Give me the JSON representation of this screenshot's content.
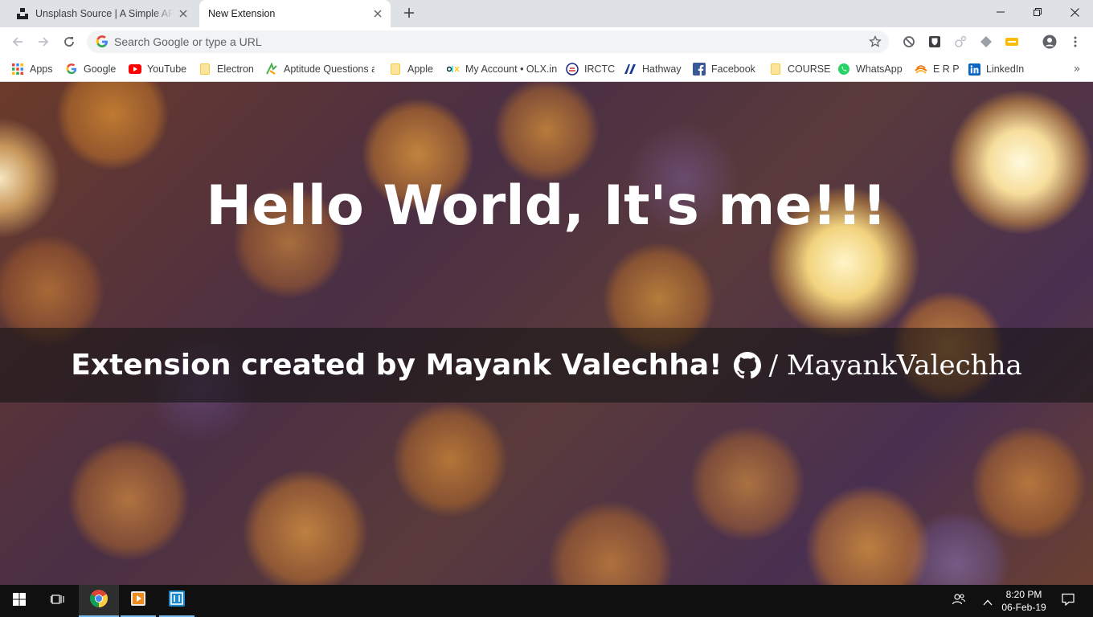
{
  "browser": {
    "tabs": [
      {
        "title": "Unsplash Source | A Simple API for Embedding Free Photos",
        "favicon": "unsplash-icon",
        "active": false
      },
      {
        "title": "New Extension",
        "favicon": "",
        "active": true
      }
    ],
    "omnibox": {
      "placeholder": "Search Google or type a URL",
      "value": ""
    },
    "bookmarks": [
      {
        "label": "Apps",
        "icon": "apps-grid-icon"
      },
      {
        "label": "Google",
        "icon": "google-icon"
      },
      {
        "label": "YouTube",
        "icon": "youtube-icon"
      },
      {
        "label": "Electron",
        "icon": "folder-icon"
      },
      {
        "label": "Aptitude Questions a",
        "icon": "aptitude-icon"
      },
      {
        "label": "Apple",
        "icon": "folder-icon"
      },
      {
        "label": "My Account • OLX.in",
        "icon": "olx-icon"
      },
      {
        "label": "IRCTC",
        "icon": "irctc-icon"
      },
      {
        "label": "Hathway",
        "icon": "hathway-icon"
      },
      {
        "label": "Facebook",
        "icon": "facebook-icon"
      },
      {
        "label": "COURSE",
        "icon": "folder-icon"
      },
      {
        "label": "WhatsApp",
        "icon": "whatsapp-icon"
      },
      {
        "label": "E R P",
        "icon": "erp-icon"
      },
      {
        "label": "LinkedIn",
        "icon": "linkedin-icon"
      }
    ]
  },
  "page": {
    "headline": "Hello World, It's me!!!",
    "credit": "Extension created by Mayank Valechha!",
    "github_user": "/ MayankValechha"
  },
  "taskbar": {
    "time": "8:20 PM",
    "date": "06-Feb-19"
  },
  "colors": {
    "tabstrip": "#dee1e6",
    "banner": "rgba(20,20,20,0.6)",
    "taskbar": "#101010",
    "accent": "#76b9ed"
  }
}
